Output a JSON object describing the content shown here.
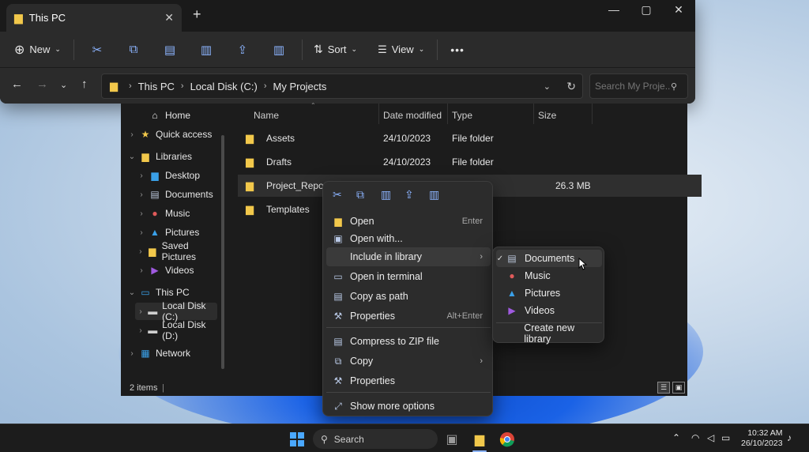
{
  "window": {
    "tab_title": "This PC",
    "tab_close": "✕",
    "new_tab": "+",
    "controls": {
      "minimize": "—",
      "maximize": "▢",
      "close": "✕"
    }
  },
  "toolbar": {
    "new_label": "New",
    "sort_label": "Sort",
    "view_label": "View",
    "more_label": "•••",
    "icons": [
      "cut-icon",
      "copy-icon",
      "paste-icon",
      "rename-icon",
      "share-icon",
      "delete-icon"
    ]
  },
  "address": {
    "crumbs": [
      "This PC",
      "Local Disk (C:)",
      "My Projects"
    ],
    "search_placeholder": "Search My Proje..."
  },
  "nav": {
    "items": [
      {
        "label": "Home",
        "icon": "home-icon",
        "glyph": "⌂",
        "color": "#e8e8e8",
        "chev": ""
      },
      {
        "label": "Quick access",
        "icon": "star-icon",
        "glyph": "★",
        "color": "#f2c84b",
        "chev": "›"
      },
      {
        "label": "Libraries",
        "icon": "folder-icon",
        "glyph": "▆",
        "color": "#f2c84b",
        "chev": "⌄"
      },
      {
        "label": "Desktop",
        "icon": "desktop-icon",
        "glyph": "▆",
        "color": "#3aa0e8",
        "chev": "›"
      },
      {
        "label": "Documents",
        "icon": "documents-icon",
        "glyph": "▤",
        "color": "#b8c4d8",
        "chev": "›"
      },
      {
        "label": "Music",
        "icon": "music-icon",
        "glyph": "●",
        "color": "#e05a5a",
        "chev": "›"
      },
      {
        "label": "Pictures",
        "icon": "pictures-icon",
        "glyph": "▲",
        "color": "#3aa0e8",
        "chev": "›"
      },
      {
        "label": "Saved Pictures",
        "icon": "folder-icon",
        "glyph": "▆",
        "color": "#f2c84b",
        "chev": "›"
      },
      {
        "label": "Videos",
        "icon": "videos-icon",
        "glyph": "▶",
        "color": "#a05ae0",
        "chev": "›"
      },
      {
        "label": "This PC",
        "icon": "pc-icon",
        "glyph": "▭",
        "color": "#3aa0e8",
        "chev": "⌄"
      },
      {
        "label": "Local Disk (C:)",
        "icon": "drive-icon",
        "glyph": "▬",
        "color": "#cfcfcf",
        "chev": "›"
      },
      {
        "label": "Local Disk (D:)",
        "icon": "drive-icon",
        "glyph": "▬",
        "color": "#cfcfcf",
        "chev": "›"
      },
      {
        "label": "Network",
        "icon": "network-icon",
        "glyph": "▦",
        "color": "#3aa0e8",
        "chev": "›"
      }
    ]
  },
  "files": {
    "columns": [
      "Name",
      "Date modified",
      "Type",
      "Size"
    ],
    "rows": [
      {
        "name": "Assets",
        "date": "24/10/2023",
        "type": "File folder",
        "size": ""
      },
      {
        "name": "Drafts",
        "date": "24/10/2023",
        "type": "File folder",
        "size": ""
      },
      {
        "name": "Project_Reports",
        "date": "",
        "type": "",
        "size": "26.3 MB"
      },
      {
        "name": "Templates",
        "date": "",
        "type": "",
        "size": ""
      }
    ]
  },
  "status": {
    "count": "2 items",
    "cursor": "|"
  },
  "context_menu": {
    "icons": [
      "cut-icon",
      "copy-icon",
      "rename-icon",
      "share-icon",
      "delete-icon"
    ],
    "items": [
      {
        "label": "Open",
        "key": "Enter"
      },
      {
        "label": "Open with...",
        "key": ""
      },
      {
        "label": "Include in library",
        "key": ""
      },
      {
        "label": "Open in terminal",
        "key": ""
      },
      {
        "label": "Copy as path",
        "key": ""
      },
      {
        "label": "Properties",
        "key": "Alt+Enter"
      },
      {
        "label": "Compress to ZIP file",
        "key": ""
      },
      {
        "label": "Copy",
        "key": ""
      },
      {
        "label": "Properties",
        "key": ""
      },
      {
        "label": "Show more options",
        "key": ""
      }
    ]
  },
  "submenu": {
    "items": [
      "Documents",
      "Music",
      "Pictures",
      "Videos"
    ],
    "create": "Create new library"
  },
  "taskbar": {
    "search_label": "Search",
    "time": "10:32 AM",
    "date": "26/10/2023",
    "chevron": "⌃"
  }
}
